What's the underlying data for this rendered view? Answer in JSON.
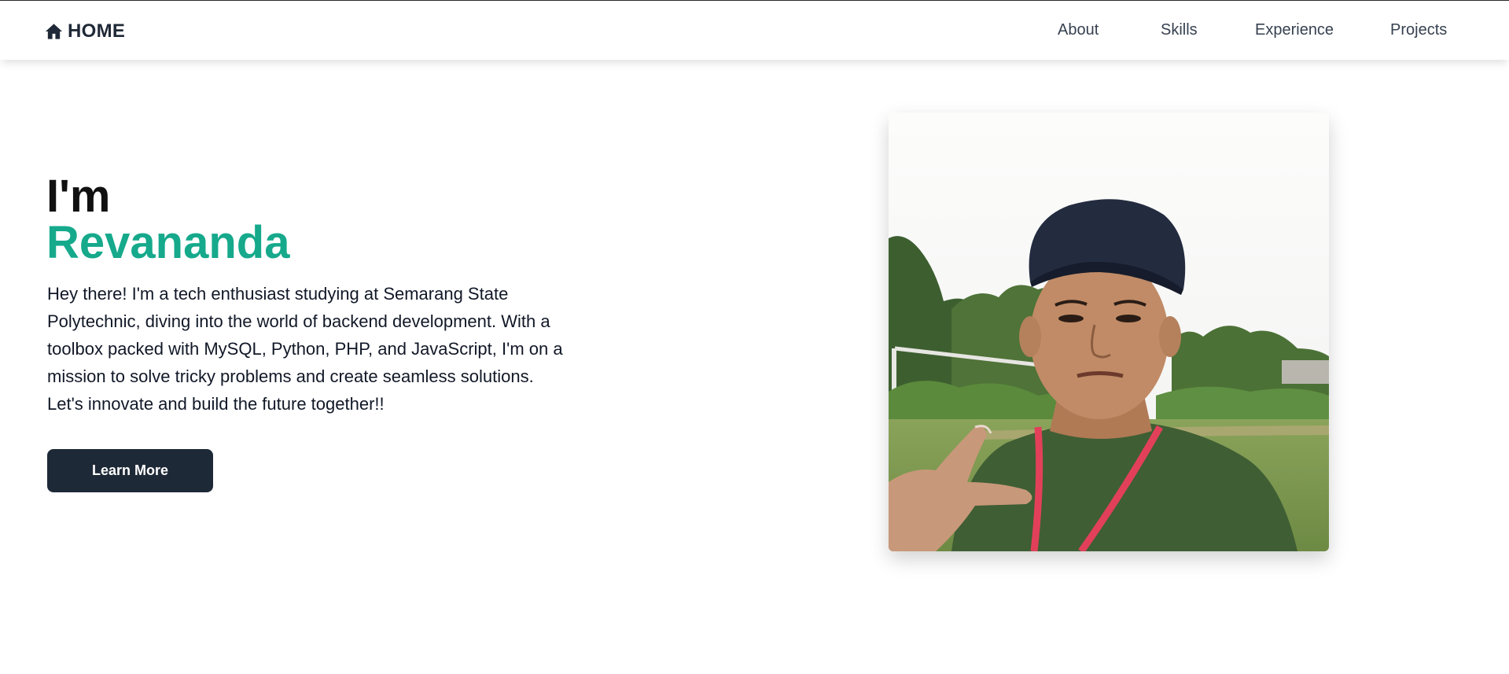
{
  "nav": {
    "brand": "HOME",
    "brand_icon": "home-icon",
    "links": [
      "About",
      "Skills",
      "Experience",
      "Projects"
    ]
  },
  "hero": {
    "greeting": "I'm",
    "name": "Revananda",
    "description": "Hey there! I'm a tech enthusiast studying at Semarang State Polytechnic, diving into the world of backend development. With a toolbox packed with MySQL, Python, PHP, and JavaScript, I'm on a mission to solve tricky problems and create seamless solutions. Let's innovate and build the future together!!",
    "button_label": "Learn More"
  },
  "colors": {
    "accent": "#16a98c",
    "button_bg": "#1e2937",
    "nav_text": "#374151"
  }
}
